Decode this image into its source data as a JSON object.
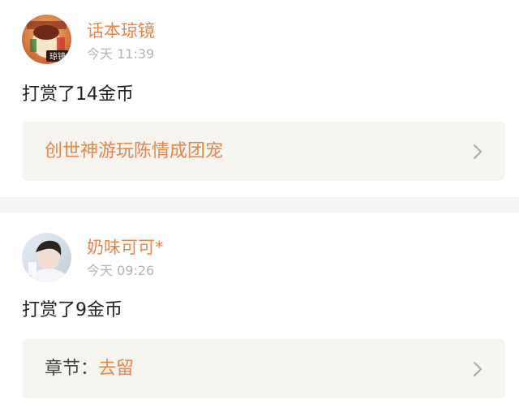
{
  "colors": {
    "accent": "#e8854a",
    "timestamp": "#b4b4b4",
    "link_box_bg": "#f6f4ef",
    "separator": "#f4f4f4"
  },
  "posts": [
    {
      "username": "话本琼镜",
      "time": "今天 11:39",
      "message": "打赏了14金币",
      "link": {
        "prefix": "",
        "text": "创世神游玩陈情成团宠"
      },
      "avatar_icon": "avatar-image",
      "avatar_badge": "琼镜"
    },
    {
      "username": "奶味可可*",
      "time": "今天 09:26",
      "message": "打赏了9金币",
      "link": {
        "prefix": "章节：",
        "text": "去留"
      },
      "avatar_icon": "avatar-image"
    }
  ],
  "icons": {
    "chevron": "chevron-right-icon"
  }
}
